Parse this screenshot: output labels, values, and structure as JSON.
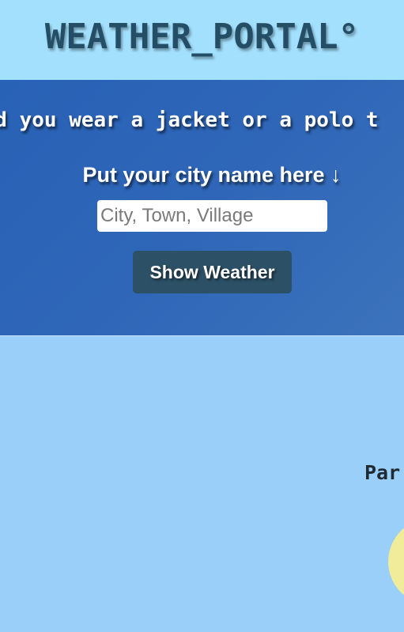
{
  "header": {
    "title": "WEATHER_PORTAL°"
  },
  "hero": {
    "marquee": "uld you wear a jacket or a polo t",
    "city_prompt": "Put your city name here ↓",
    "search": {
      "placeholder": "City, Town, Village",
      "value": ""
    },
    "button_label": "Show Weather"
  },
  "results": {
    "location": "Par",
    "icon": "sun-icon"
  },
  "colors": {
    "header_bg": "#a3e0fd",
    "hero_bg": "#2f66b8",
    "page_bg": "#99cff8",
    "button_bg": "#2c5166",
    "title_color": "#244e66",
    "sun": "#f1ec99"
  }
}
